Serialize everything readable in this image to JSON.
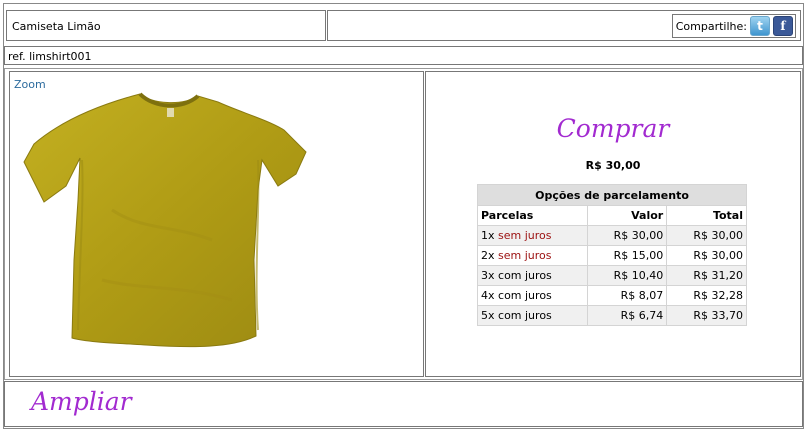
{
  "product": {
    "title": "Camiseta Limão",
    "reference": "ref. limshirt001",
    "price": "R$ 30,00",
    "image_color": "#b8a51a"
  },
  "share": {
    "label": "Compartilhe:",
    "icons": [
      "twitter-icon",
      "facebook-icon"
    ]
  },
  "links": {
    "zoom": "Zoom",
    "buy": "Comprar",
    "enlarge": "Ampliar"
  },
  "installments": {
    "caption": "Opções de parcelamento",
    "headers": [
      "Parcelas",
      "Valor",
      "Total"
    ],
    "rows": [
      {
        "count": "1x",
        "terms": "sem juros",
        "value": "R$ 30,00",
        "total": "R$ 30,00"
      },
      {
        "count": "2x",
        "terms": "sem juros",
        "value": "R$ 15,00",
        "total": "R$ 30,00"
      },
      {
        "count": "3x",
        "terms": "com juros",
        "value": "R$ 10,40",
        "total": "R$ 31,20"
      },
      {
        "count": "4x",
        "terms": "com juros",
        "value": "R$ 8,07",
        "total": "R$ 32,28"
      },
      {
        "count": "5x",
        "terms": "com juros",
        "value": "R$ 6,74",
        "total": "R$ 33,70"
      }
    ]
  },
  "colors": {
    "accent_script": "#a22ad0",
    "interest_free": "#9b1010",
    "link": "#2d6c9e"
  }
}
